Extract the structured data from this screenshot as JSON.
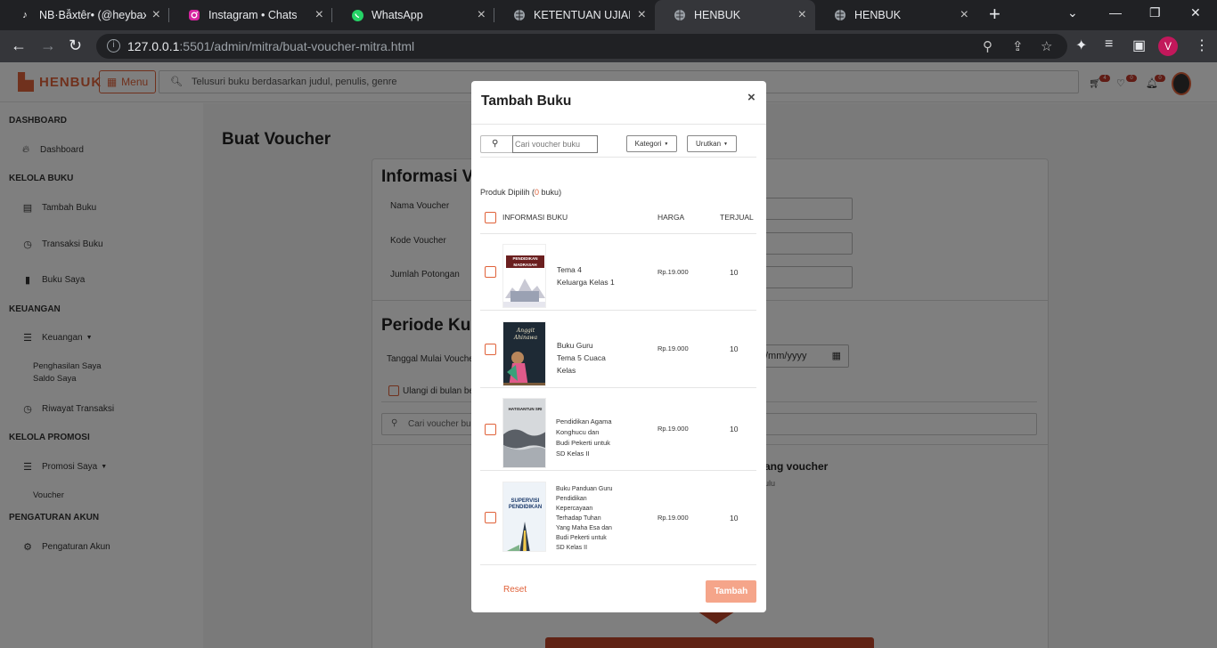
{
  "browser": {
    "tabs": [
      {
        "label": "NB·Bẫxtêr• (@heybax",
        "icon": "tiktok-icon"
      },
      {
        "label": "Instagram • Chats",
        "icon": "instagram-icon"
      },
      {
        "label": "WhatsApp",
        "icon": "whatsapp-icon"
      },
      {
        "label": "KETENTUAN UJIAN PR",
        "icon": "globe-icon"
      },
      {
        "label": "HENBUK",
        "icon": "globe-icon"
      },
      {
        "label": "HENBUK",
        "icon": "globe-icon"
      }
    ],
    "url_host": "127.0.0.1",
    "url_path": ":5501/admin/mitra/buat-voucher-mitra.html",
    "profile_initial": "V"
  },
  "topnav": {
    "brand": "HENBUK",
    "menu_label": "Menu",
    "search_placeholder": "Telusuri buku berdasarkan judul, penulis, genre",
    "cart_count": "4",
    "wishlist_count": "0",
    "notif_count": "0"
  },
  "sidebar": {
    "dashboard_head": "DASHBOARD",
    "dashboard": "Dashboard",
    "kelola_buku_head": "KELOLA BUKU",
    "tambah_buku": "Tambah Buku",
    "transaksi_buku": "Transaksi Buku",
    "buku_saya": "Buku Saya",
    "keuangan_head": "KEUANGAN",
    "keuangan": "Keuangan",
    "penghasilan": "Penghasilan Saya",
    "saldo": "Saldo Saya",
    "riwayat": "Riwayat Transaksi",
    "promosi_head": "KELOLA PROMOSI",
    "promosi": "Promosi Saya",
    "voucher": "Voucher",
    "akun_head": "PENGATURAN AKUN",
    "akun": "Pengaturan Akun"
  },
  "background": {
    "page_title": "Buat Voucher",
    "info_title": "Informasi V",
    "nama_voucher": "Nama Voucher",
    "kode_voucher": "Kode Voucher",
    "jumlah_potongan": "Jumlah Potongan",
    "periode_title": "Periode Kup",
    "tanggal_mulai": "Tanggal Mulai Voucher",
    "date_placeholder": "/mm/yyyy",
    "ulangi": "Ulangi di bulan be",
    "search_placeholder": "Cari voucher buk",
    "empty_heading": "ang voucher",
    "empty_sub": "ulu"
  },
  "modal": {
    "title": "Tambah Buku",
    "search_placeholder": "Cari voucher buku",
    "kategori": "Kategori",
    "urutkan": "Urutkan",
    "selected_prefix": "Produk Dipilih (",
    "selected_count": "0",
    "selected_suffix": " buku)",
    "col_info": "INFORMASI BUKU",
    "col_price": "HARGA",
    "col_sold": "TERJUAL",
    "reset": "Reset",
    "add": "Tambah",
    "books": [
      {
        "title_lines": [
          "Tema 4",
          "Keluarga Kelas 1"
        ],
        "price": "Rp.19.000",
        "sold": "10",
        "cover_text": "PENDIDIKAN MADRASAH"
      },
      {
        "title_lines": [
          "Buku Guru",
          "Tema 5 Cuaca",
          "Kelas"
        ],
        "price": "Rp.19.000",
        "sold": "10",
        "cover_text": "Anggit Ahinawa"
      },
      {
        "title_lines": [
          "Pendidikan Agama",
          "Konghucu dan",
          "Budi Pekerti untuk",
          "SD Kelas II"
        ],
        "price": "Rp.19.000",
        "sold": "10",
        "cover_text": "HATISANTUN SRI"
      },
      {
        "title_lines": [
          "Buku Panduan Guru",
          "Pendidikan",
          "Kepercayaan",
          "Terhadap Tuhan",
          "Yang Maha Esa dan",
          "Budi Pekerti untuk",
          "SD Kelas II"
        ],
        "price": "Rp.19.000",
        "sold": "10",
        "cover_text": "SUPERVISI PENDIDIKAN"
      }
    ]
  },
  "colors": {
    "accent": "#e0623a",
    "badge": "#c0392b",
    "add_button": "#f5a58a"
  }
}
